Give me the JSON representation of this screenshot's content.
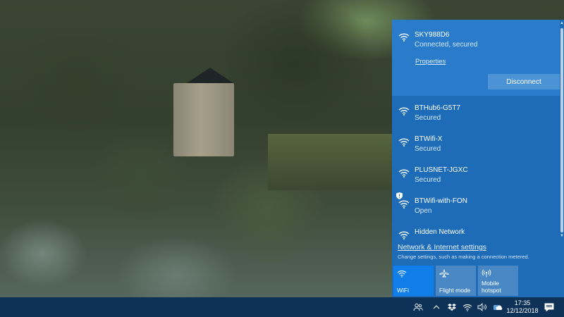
{
  "colors": {
    "flyout_bg": "#1e6cb8",
    "connected_bg": "#2a7ccb",
    "tile_active": "#0f7ee8",
    "tile_inactive": "#4a88c5",
    "taskbar_bg": "#0d3157"
  },
  "flyout": {
    "connected": {
      "name": "SKY988D6",
      "status": "Connected, secured",
      "properties_label": "Properties",
      "disconnect_label": "Disconnect",
      "icon": "wifi-icon"
    },
    "networks": [
      {
        "name": "BTHub6-G5T7",
        "status": "Secured",
        "icon": "wifi-icon"
      },
      {
        "name": "BTWifi-X",
        "status": "Secured",
        "icon": "wifi-icon"
      },
      {
        "name": "PLUSNET-JGXC",
        "status": "Secured",
        "icon": "wifi-icon"
      },
      {
        "name": "BTWifi-with-FON",
        "status": "Open",
        "icon": "wifi-shield-icon"
      },
      {
        "name": "Hidden Network",
        "status": "",
        "icon": "wifi-icon"
      }
    ],
    "settings_link": "Network & Internet settings",
    "settings_desc": "Change settings, such as making a connection metered.",
    "tiles": [
      {
        "label": "WiFi",
        "icon": "wifi-icon",
        "active": true
      },
      {
        "label": "Flight mode",
        "icon": "airplane-icon",
        "active": false
      },
      {
        "label": "Mobile hotspot",
        "label_lines": [
          "Mobile",
          "hotspot"
        ],
        "icon": "hotspot-icon",
        "active": false
      }
    ]
  },
  "taskbar": {
    "time": "17:35",
    "date": "12/12/2018",
    "tray_icons": [
      "people-icon",
      "chevron-up-icon",
      "dropbox-icon",
      "wifi-icon",
      "volume-icon",
      "cloud-icon"
    ],
    "notification_icon": "action-center-icon"
  }
}
